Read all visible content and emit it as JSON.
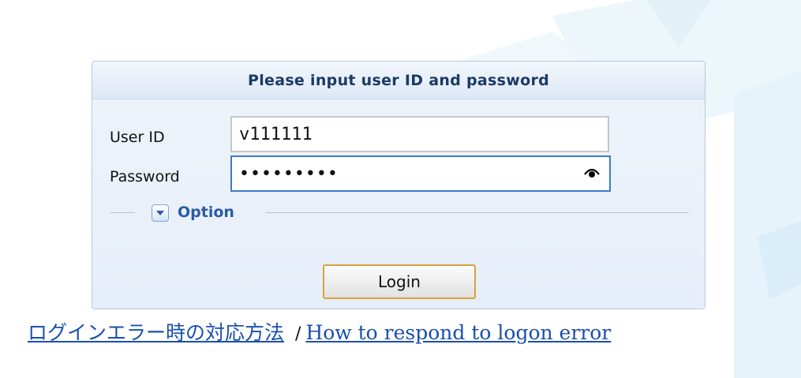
{
  "login": {
    "title": "Please input user ID and password",
    "user_id_label": "User ID",
    "user_id_value": "v111111",
    "password_label": "Password",
    "password_value": "hidden123",
    "option_label": "Option",
    "login_label": "Login"
  },
  "links": {
    "jp": "ログインエラー時の対応方法",
    "separator": "/",
    "en": "How to respond to logon error"
  },
  "icons": {
    "password_toggle": "eye-icon",
    "option_expand": "chevron-down-icon"
  },
  "colors": {
    "panel_border": "#b6c9e2",
    "title_text": "#1b3a66",
    "password_focus_border": "#3f79c8",
    "login_border": "#d8a33c",
    "link": "#1a4fb0"
  }
}
